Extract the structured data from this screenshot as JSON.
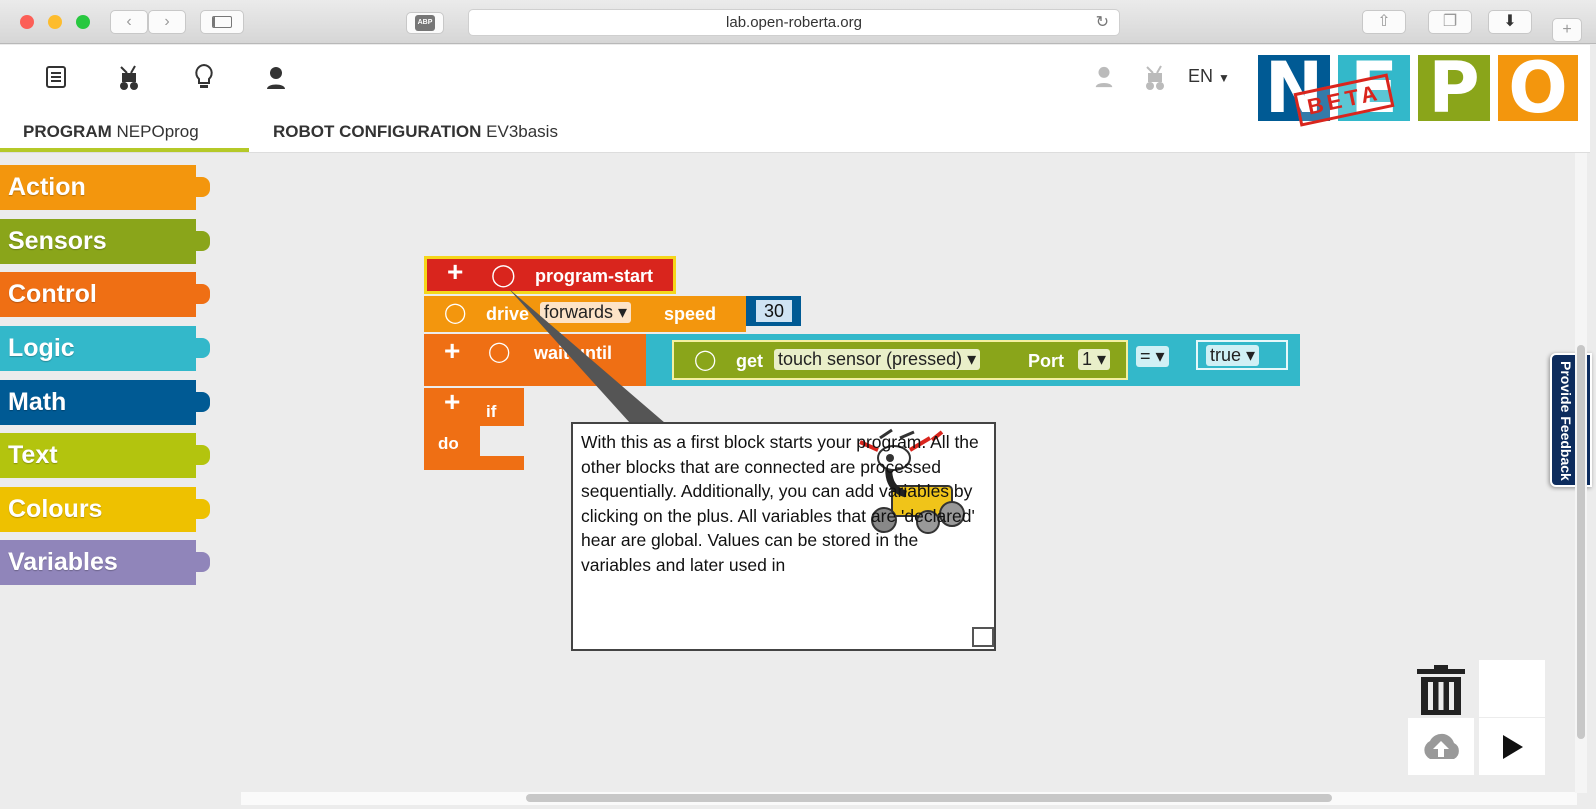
{
  "browser": {
    "url": "lab.open-roberta.org",
    "adblock_label": "ABP"
  },
  "header": {
    "tabs": [
      {
        "title": "PROGRAM",
        "name": "NEPOprog"
      },
      {
        "title": "ROBOT CONFIGURATION",
        "name": "EV3basis"
      }
    ],
    "language": "EN",
    "logo_letters": [
      "N",
      "E",
      "P",
      "O"
    ],
    "logo_stamp": "BETA"
  },
  "toolbox": {
    "categories": [
      {
        "label": "Action",
        "color": "#f3960d"
      },
      {
        "label": "Sensors",
        "color": "#8aa51a"
      },
      {
        "label": "Control",
        "color": "#ef6f14"
      },
      {
        "label": "Logic",
        "color": "#33b8ca"
      },
      {
        "label": "Math",
        "color": "#005a94"
      },
      {
        "label": "Text",
        "color": "#b3c40e"
      },
      {
        "label": "Colours",
        "color": "#eec100"
      },
      {
        "label": "Variables",
        "color": "#9085ba"
      }
    ]
  },
  "blocks": {
    "program_start": "program-start",
    "drive": "drive",
    "drive_direction": "forwards",
    "speed": "speed",
    "speed_value": "30",
    "wait_until": "wait until",
    "get": "get",
    "sensor": "touch sensor (pressed)",
    "port_label": "Port",
    "port_value": "1",
    "operator": "=",
    "bool_value": "true",
    "if": "if",
    "do": "do"
  },
  "tooltip": {
    "text": "With this as a first block starts your program. All the other blocks that are connected are processed sequentially. Additionally, you can add variables by clicking on the plus. All variables that are 'declared' hear are global. Values can be stored in the variables and later used in"
  },
  "feedback": "Provide Feedback",
  "colors": {
    "program_start": "#d9251d",
    "drive": "#f3960d",
    "control": "#ef6f14",
    "sensor": "#8aa51a",
    "logic": "#33b8ca",
    "math": "#005a94",
    "accent": "#b5c928"
  }
}
